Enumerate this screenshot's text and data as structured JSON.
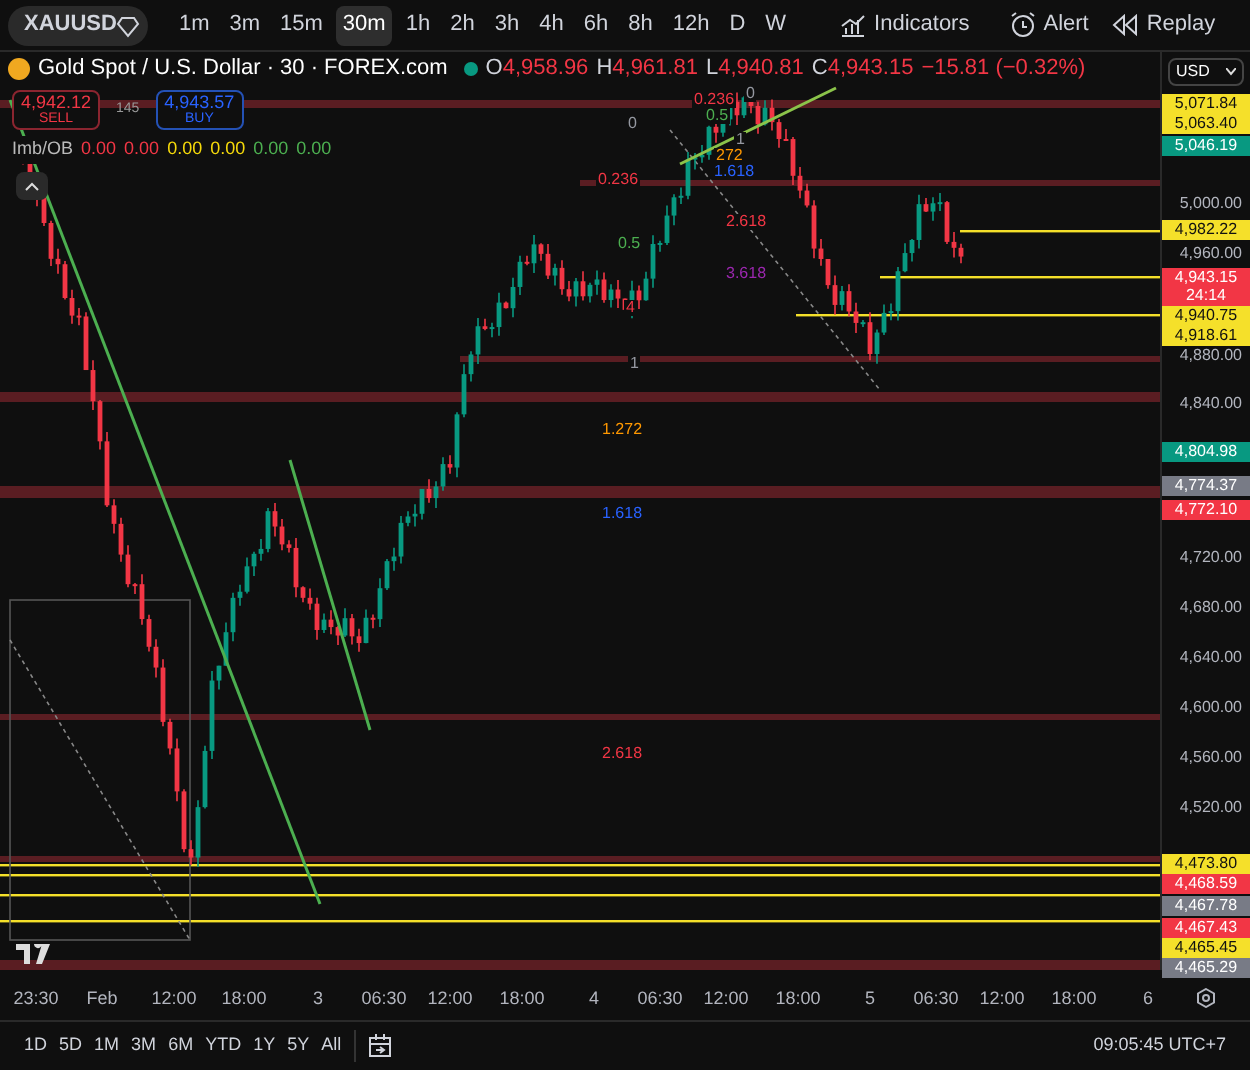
{
  "toolbar": {
    "symbol": "XAUUSD",
    "intervals": [
      {
        "label": "1m",
        "selected": false
      },
      {
        "label": "3m",
        "selected": false
      },
      {
        "label": "15m",
        "selected": false
      },
      {
        "label": "30m",
        "selected": true
      },
      {
        "label": "1h",
        "selected": false
      },
      {
        "label": "2h",
        "selected": false
      },
      {
        "label": "3h",
        "selected": false
      },
      {
        "label": "4h",
        "selected": false
      },
      {
        "label": "6h",
        "selected": false
      },
      {
        "label": "8h",
        "selected": false
      },
      {
        "label": "12h",
        "selected": false
      },
      {
        "label": "D",
        "selected": false
      },
      {
        "label": "W",
        "selected": false
      }
    ],
    "indicators": "Indicators",
    "alert": "Alert",
    "replay": "Replay"
  },
  "legend": {
    "title": "Gold Spot / U.S. Dollar · 30 · FOREX.com",
    "ohlc": [
      {
        "label": "O",
        "value": "4,958.96"
      },
      {
        "label": "H",
        "value": "4,961.81"
      },
      {
        "label": "L",
        "value": "4,940.81"
      },
      {
        "label": "C",
        "value": "4,943.15"
      }
    ],
    "change": "−15.81 (−0.32%)"
  },
  "trade": {
    "sell_price": "4,942.12",
    "sell_label": "SELL",
    "spread": "145",
    "buy_price": "4,943.57",
    "buy_label": "BUY"
  },
  "indicator": {
    "name": "Imb/OB",
    "values": [
      {
        "text": "0.00",
        "color": "#f23645"
      },
      {
        "text": "0.00",
        "color": "#f23645"
      },
      {
        "text": "0.00",
        "color": "#f5d90a"
      },
      {
        "text": "0.00",
        "color": "#f5d90a"
      },
      {
        "text": "0.00",
        "color": "#4caf50"
      },
      {
        "text": "0.00",
        "color": "#4caf50"
      }
    ]
  },
  "fib_labels": [
    {
      "text": "0",
      "color": "#9598a1"
    },
    {
      "text": "0.236",
      "color": "#f23645"
    },
    {
      "text": "0.5",
      "color": "#4caf50"
    },
    {
      "text": "4",
      "color": "#f23645"
    },
    {
      "text": "1",
      "color": "#9598a1"
    },
    {
      "text": "1.272",
      "color": "#ff9800"
    },
    {
      "text": "1.618",
      "color": "#2962ff"
    },
    {
      "text": "2.618",
      "color": "#f23645"
    },
    {
      "text": "0",
      "color": "#9598a1"
    },
    {
      "text": "0.236",
      "color": "#f23645"
    },
    {
      "text": "0.5",
      "color": "#4caf50"
    },
    {
      "text": "1",
      "color": "#9598a1"
    },
    {
      "text": "272",
      "color": "#ff9800"
    },
    {
      "text": "1.618",
      "color": "#2962ff"
    },
    {
      "text": "2.618",
      "color": "#f23645"
    },
    {
      "text": "3.618",
      "color": "#9c27b0"
    }
  ],
  "price_axis": {
    "currency": "USD",
    "scale": [
      "5,000.00",
      "4,960.00",
      "4,880.00",
      "4,840.00",
      "4,720.00",
      "4,680.00",
      "4,640.00",
      "4,600.00",
      "4,560.00",
      "4,520.00"
    ],
    "tags": [
      {
        "text": "5,071.84",
        "color": "#f5e02a"
      },
      {
        "text": "5,063.40",
        "color": "#f5e02a"
      },
      {
        "text": "5,046.19",
        "color": "#089981"
      },
      {
        "text": "4,982.22",
        "color": "#f5e02a"
      },
      {
        "text": "4,943.15",
        "countdown": "24:14",
        "color": "#f23645"
      },
      {
        "text": "4,940.75",
        "color": "#f5e02a"
      },
      {
        "text": "4,918.61",
        "color": "#f5e02a"
      },
      {
        "text": "4,804.98",
        "color": "#089981"
      },
      {
        "text": "4,774.37",
        "color": "#787b86"
      },
      {
        "text": "4,772.10",
        "color": "#f23645"
      },
      {
        "text": "4,473.80",
        "color": "#f5e02a"
      },
      {
        "text": "4,468.59",
        "color": "#f23645"
      },
      {
        "text": "4,467.78",
        "color": "#787b86"
      },
      {
        "text": "4,467.43",
        "color": "#f23645"
      },
      {
        "text": "4,465.45",
        "color": "#f5e02a"
      },
      {
        "text": "4,465.29",
        "color": "#787b86"
      }
    ]
  },
  "time_axis": [
    "23:30",
    "Feb",
    "12:00",
    "18:00",
    "3",
    "06:30",
    "12:00",
    "18:00",
    "4",
    "06:30",
    "12:00",
    "18:00",
    "5",
    "06:30",
    "12:00",
    "18:00",
    "6"
  ],
  "ranges": [
    "1D",
    "5D",
    "1M",
    "3M",
    "6M",
    "YTD",
    "1Y",
    "5Y",
    "All"
  ],
  "clock": "09:05:45 UTC+7"
}
